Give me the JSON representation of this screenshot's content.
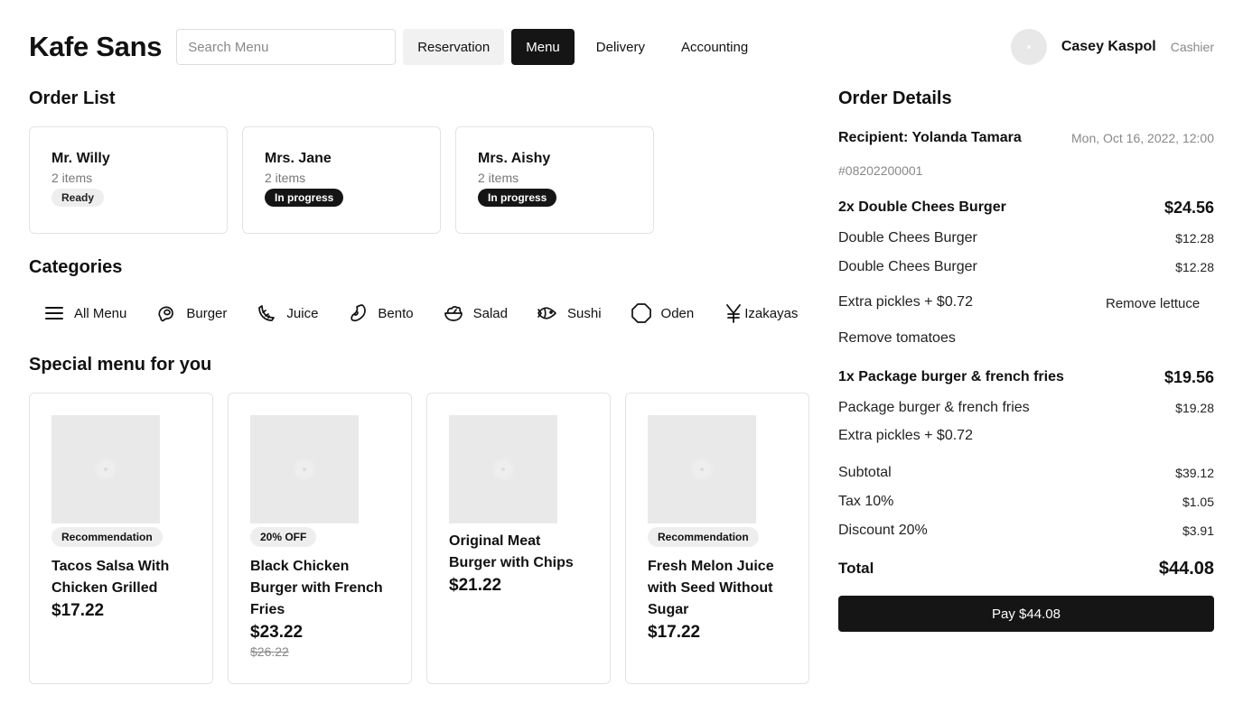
{
  "header": {
    "logo": "Kafe Sans",
    "search_placeholder": "Search Menu",
    "nav": [
      {
        "label": "Reservation"
      },
      {
        "label": "Menu"
      },
      {
        "label": "Delivery"
      },
      {
        "label": "Accounting"
      }
    ],
    "user": {
      "name": "Casey Kaspol",
      "role": "Cashier"
    }
  },
  "order_list": {
    "title": "Order List",
    "orders": [
      {
        "name": "Mr. Willy",
        "items": "2 items",
        "status": "Ready"
      },
      {
        "name": "Mrs. Jane",
        "items": "2 items",
        "status": "In progress"
      },
      {
        "name": "Mrs. Aishy",
        "items": "2 items",
        "status": "In progress"
      }
    ]
  },
  "categories": {
    "title": "Categories",
    "items": [
      {
        "label": "All Menu",
        "icon": "menu-lines-icon"
      },
      {
        "label": "Burger",
        "icon": "burger-icon"
      },
      {
        "label": "Juice",
        "icon": "juice-icon"
      },
      {
        "label": "Bento",
        "icon": "bento-icon"
      },
      {
        "label": "Salad",
        "icon": "salad-icon"
      },
      {
        "label": "Sushi",
        "icon": "sushi-icon"
      },
      {
        "label": "Oden",
        "icon": "oden-icon"
      },
      {
        "label": "Izakayas",
        "icon": "yen-icon"
      }
    ]
  },
  "special_menu": {
    "title": "Special menu for you",
    "items": [
      {
        "badge": "Recommendation",
        "title": "Tacos Salsa With Chicken Grilled",
        "price": "$17.22",
        "old_price": ""
      },
      {
        "badge": "20% OFF",
        "title": "Black Chicken Burger with French Fries",
        "price": "$23.22",
        "old_price": "$26.22"
      },
      {
        "badge": "",
        "title": "Original Meat Burger with Chips",
        "price": "$21.22",
        "old_price": ""
      },
      {
        "badge": "Recommendation",
        "title": "Fresh Melon Juice with Seed Without Sugar",
        "price": "$17.22",
        "old_price": ""
      }
    ]
  },
  "order_details": {
    "title": "Order Details",
    "recipient": "Recipient: Yolanda Tamara",
    "date": "Mon, Oct 16, 2022, 12:00",
    "order_id": "#08202200001",
    "groups": [
      {
        "head": "2x Double Chees Burger",
        "head_price": "$24.56",
        "lines": [
          {
            "label": "Double Chees Burger",
            "price": "$12.28"
          },
          {
            "label": "Double Chees Burger",
            "price": "$12.28"
          }
        ],
        "mods_a": "Extra pickles + $0.72",
        "mods_b": "Remove lettuce",
        "mods_c": "Remove tomatoes"
      },
      {
        "head": "1x Package burger & french fries",
        "head_price": "$19.56",
        "lines": [
          {
            "label": "Package burger & french fries",
            "price": "$19.28"
          }
        ],
        "mods_a": "Extra pickles + $0.72"
      }
    ],
    "subtotal": {
      "label": "Subtotal",
      "value": "$39.12"
    },
    "tax": {
      "label": "Tax 10%",
      "value": "$1.05"
    },
    "discount": {
      "label": "Discount 20%",
      "value": "$3.91"
    },
    "total": {
      "label": "Total",
      "value": "$44.08"
    },
    "pay_label": "Pay $44.08"
  }
}
